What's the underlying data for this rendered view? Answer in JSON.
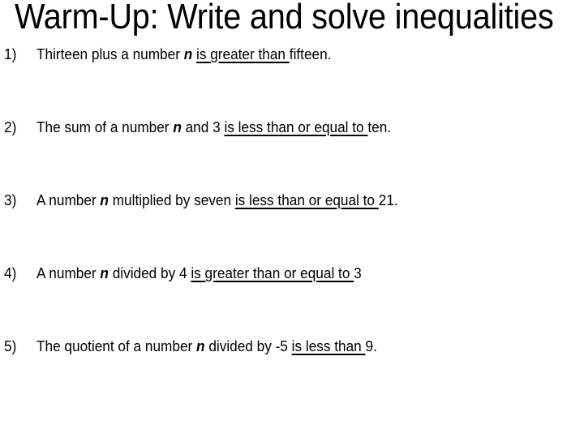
{
  "slide": {
    "title": "Warm-Up: Write and solve inequalities",
    "background_color": "#FFFFFF",
    "text_color": "#000000",
    "items": [
      {
        "marker": "1)",
        "parts": {
          "lead": "Thirteen plus a number ",
          "variable": "n",
          "mid": " ",
          "underlined": "is greater than ",
          "tail": "fifteen."
        },
        "full_text": "Thirteen plus a number n is greater than fifteen."
      },
      {
        "marker": "2)",
        "parts": {
          "lead": "The sum of a number ",
          "variable": "n",
          "mid": " and 3 ",
          "underlined": "is less than or equal to ",
          "tail": "ten."
        },
        "full_text": "The sum of a number n and 3 is less than or equal to ten."
      },
      {
        "marker": "3)",
        "parts": {
          "lead": "A number ",
          "variable": "n",
          "mid": " multiplied by seven ",
          "underlined": "is less than or equal to ",
          "tail": "21."
        },
        "full_text": "A number n multiplied by seven is less than or equal to 21."
      },
      {
        "marker": "4)",
        "parts": {
          "lead": "A number ",
          "variable": "n",
          "mid": " divided by 4 ",
          "underlined": "is greater than or equal to ",
          "tail": "3"
        },
        "full_text": "A number n divided by 4 is greater than or equal to 3"
      },
      {
        "marker": "5)",
        "parts": {
          "lead": "The quotient of a number ",
          "variable": "n",
          "mid": " divided by -5 ",
          "underlined": "is less than ",
          "tail": "9."
        },
        "full_text": "The quotient of a number n divided by -5 is less than 9."
      }
    ]
  }
}
